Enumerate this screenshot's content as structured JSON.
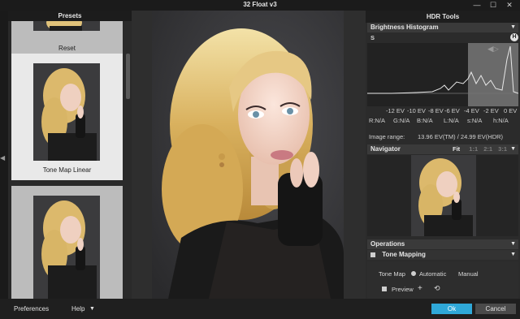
{
  "window": {
    "title": "32 Float v3",
    "minimize_glyph": "—",
    "maximize_glyph": "☐",
    "close_glyph": "✕"
  },
  "presets": {
    "header": "Presets",
    "items": [
      {
        "label": "Reset"
      },
      {
        "label": "Tone Map Linear"
      },
      {
        "label": ""
      }
    ]
  },
  "hdr_tools": {
    "header": "HDR Tools",
    "histogram": {
      "title": "Brightness Histogram",
      "s_marker": "S",
      "h_marker": "H",
      "ev_labels": [
        "-12 EV",
        "-10 EV",
        "-8 EV",
        "-6 EV",
        "-4 EV",
        "-2 EV",
        "0 EV"
      ],
      "readouts": [
        "R:N/A",
        "G:N/A",
        "B:N/A",
        "L:N/A",
        "s:N/A",
        "h:N/A"
      ],
      "image_range_label": "Image range:",
      "image_range_value": "13.96 EV(TM) / 24.99 EV(HDR)"
    },
    "navigator": {
      "title": "Navigator",
      "fit": "Fit",
      "zooms": [
        "1:1",
        "2:1",
        "3:1"
      ]
    },
    "operations": {
      "title": "Operations",
      "tone_mapping_title": "Tone Mapping",
      "tone_map_label": "Tone Map",
      "automatic": "Automatic",
      "manual": "Manual",
      "preview": "Preview",
      "selected_mode": "Automatic"
    }
  },
  "bottom": {
    "preferences": "Preferences",
    "help": "Help",
    "ok": "Ok",
    "cancel": "Cancel"
  },
  "colors": {
    "accent": "#2fa8d8",
    "panel": "#2b2b2b",
    "selected_card": "#e9e9e9"
  }
}
